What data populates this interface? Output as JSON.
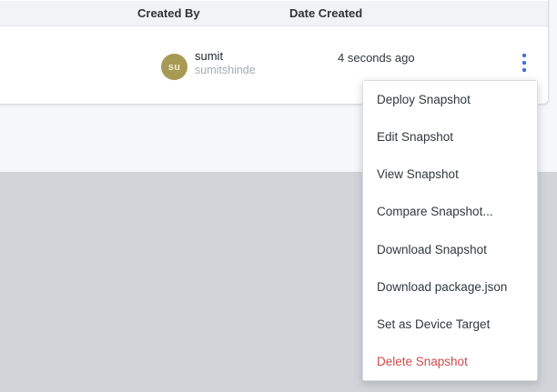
{
  "table": {
    "columns": [
      {
        "label": "Created By"
      },
      {
        "label": "Date Created"
      }
    ],
    "row": {
      "user": {
        "initials": "su",
        "name": "sumit",
        "username": "sumitshinde"
      },
      "date_created": "4 seconds ago"
    }
  },
  "menu": {
    "items": [
      {
        "label": "Deploy Snapshot",
        "danger": false
      },
      {
        "label": "Edit Snapshot",
        "danger": false
      },
      {
        "label": "View Snapshot",
        "danger": false
      },
      {
        "label": "Compare Snapshot...",
        "danger": false
      },
      {
        "label": "Download Snapshot",
        "danger": false
      },
      {
        "label": "Download package.json",
        "danger": false
      },
      {
        "label": "Set as Device Target",
        "danger": false
      },
      {
        "label": "Delete Snapshot",
        "danger": true
      }
    ]
  },
  "icons": {
    "row_actions": "kebab-menu-icon"
  },
  "colors": {
    "accent_blue": "#3a6fe4",
    "danger_red": "#ce4a4e",
    "avatar_bg": "#a79a54",
    "header_bg": "#f2f3f5",
    "page_bg": "#f6f7f9",
    "page_lower_bg": "#d2d4d9"
  }
}
